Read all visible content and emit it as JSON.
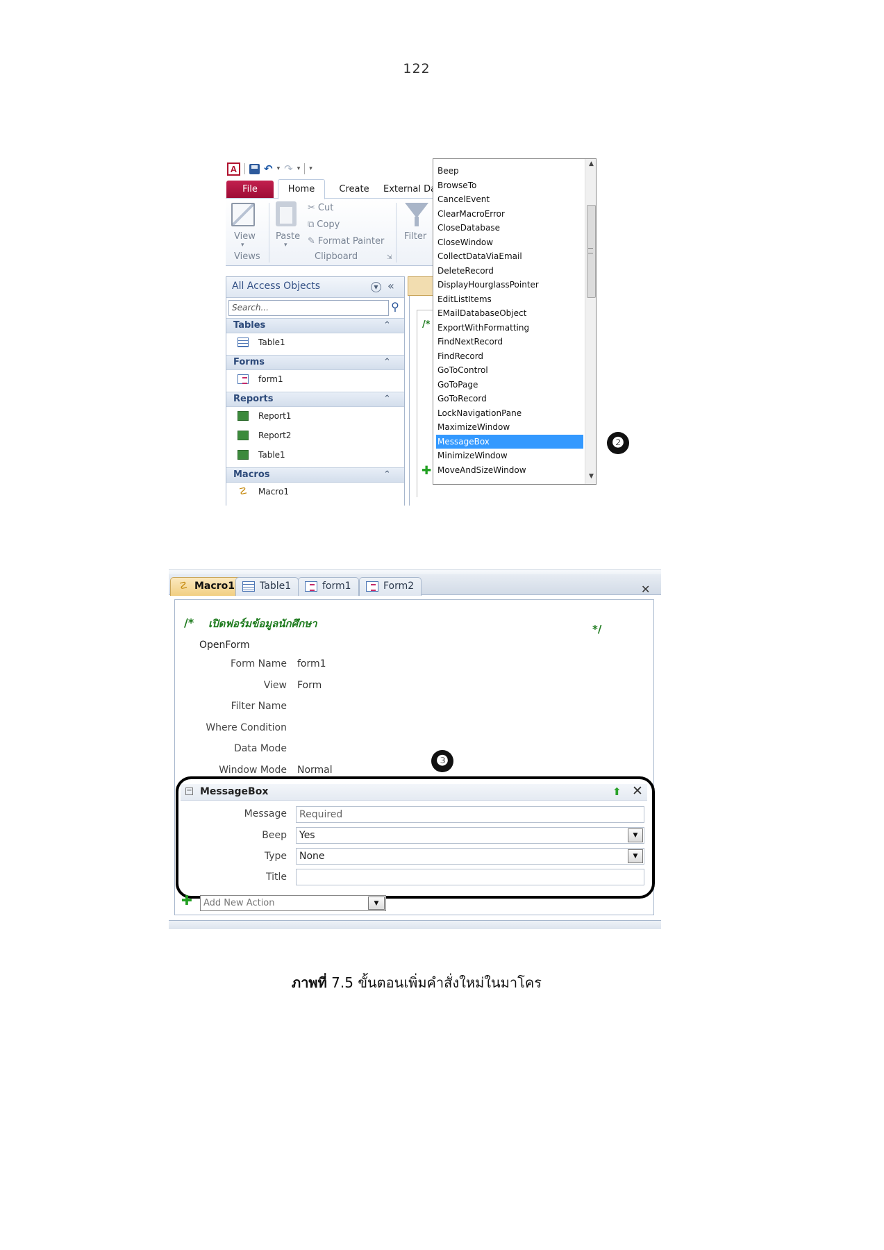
{
  "page_number": "122",
  "screenshot_top": {
    "quick_access": {
      "logo": "A"
    },
    "ribbon": {
      "tabs": {
        "file": "File",
        "home": "Home",
        "create": "Create",
        "external": "External Da"
      },
      "view_label": "View",
      "paste_label": "Paste",
      "cut_label": "Cut",
      "copy_label": "Copy",
      "format_painter_label": "Format Painter",
      "filter_label": "Filter",
      "group_views": "Views",
      "group_clipboard": "Clipboard"
    },
    "nav_pane": {
      "title": "All Access Objects",
      "search_placeholder": "Search...",
      "groups": [
        {
          "title": "Tables",
          "items": [
            "Table1"
          ]
        },
        {
          "title": "Forms",
          "items": [
            "form1"
          ]
        },
        {
          "title": "Reports",
          "items": [
            "Report1",
            "Report2",
            "Table1"
          ]
        },
        {
          "title": "Macros",
          "items": [
            "Macro1"
          ]
        }
      ]
    },
    "doc_comment": "/*",
    "action_list": {
      "items": [
        "Beep",
        "BrowseTo",
        "CancelEvent",
        "ClearMacroError",
        "CloseDatabase",
        "CloseWindow",
        "CollectDataViaEmail",
        "DeleteRecord",
        "DisplayHourglassPointer",
        "EditListItems",
        "EMailDatabaseObject",
        "ExportWithFormatting",
        "FindNextRecord",
        "FindRecord",
        "GoToControl",
        "GoToPage",
        "GoToRecord",
        "LockNavigationPane",
        "MaximizeWindow",
        "MessageBox",
        "MinimizeWindow",
        "MoveAndSizeWindow"
      ],
      "selected": "MessageBox"
    },
    "badge": "❷"
  },
  "screenshot_bottom": {
    "tabs": [
      "Macro1",
      "Table1",
      "form1",
      "Form2"
    ],
    "comment_open": "/*",
    "comment_text": "เปิดฟอร์มข้อมูลนักศึกษา",
    "comment_close": "*/",
    "action_open_form": {
      "title": "OpenForm",
      "args": [
        {
          "label": "Form Name",
          "value": "form1"
        },
        {
          "label": "View",
          "value": "Form"
        },
        {
          "label": "Filter Name",
          "value": ""
        },
        {
          "label": "Where Condition",
          "value": ""
        },
        {
          "label": "Data Mode",
          "value": ""
        },
        {
          "label": "Window Mode",
          "value": "Normal"
        }
      ]
    },
    "message_box": {
      "title": "MessageBox",
      "message_label": "Message",
      "message_value": "Required",
      "beep_label": "Beep",
      "beep_value": "Yes",
      "type_label": "Type",
      "type_value": "None",
      "title_label": "Title",
      "title_value": ""
    },
    "add_new_action_placeholder": "Add New Action",
    "badge": "❸"
  },
  "caption": {
    "prefix": "ภาพที่",
    "text": " 7.5 ขั้นตอนเพิ่มคำสั่งใหม่ในมาโคร"
  }
}
